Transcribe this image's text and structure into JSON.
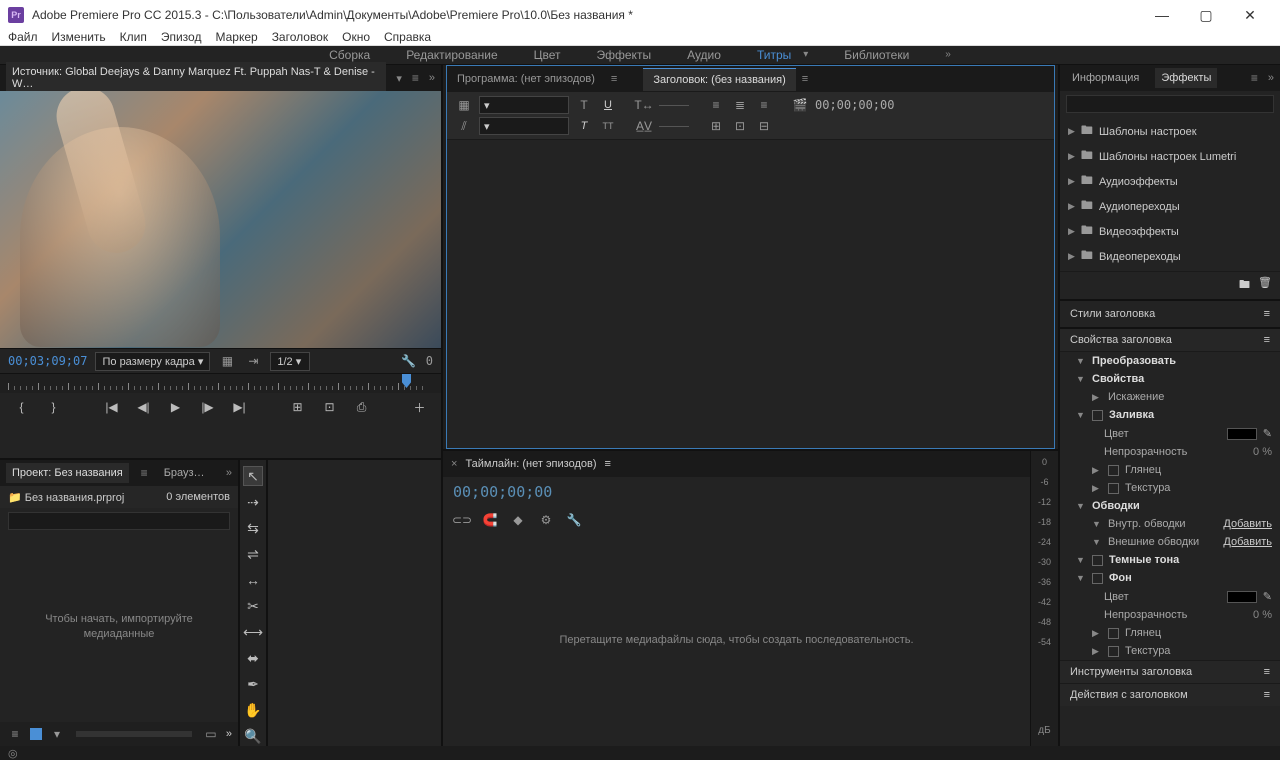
{
  "titlebar": {
    "app_icon": "Pr",
    "title": "Adobe Premiere Pro CC 2015.3 - C:\\Пользователи\\Admin\\Документы\\Adobe\\Premiere Pro\\10.0\\Без названия *"
  },
  "menubar": [
    "Файл",
    "Изменить",
    "Клип",
    "Эпизод",
    "Маркер",
    "Заголовок",
    "Окно",
    "Справка"
  ],
  "workspaces": {
    "items": [
      "Сборка",
      "Редактирование",
      "Цвет",
      "Эффекты",
      "Аудио",
      "Титры",
      "Библиотеки"
    ],
    "active": "Титры"
  },
  "source": {
    "tab": "Источник: Global Deejays & Danny Marquez Ft. Puppah Nas-T & Denise - W…",
    "timecode": "00;03;09;07",
    "fit_label": "По размеру кадра",
    "scale": "1/2",
    "end_tc": "0"
  },
  "title_editor": {
    "tab_program": "Программа: (нет эпизодов)",
    "tab_title": "Заголовок: (без названия)",
    "tc": "00;00;00;00"
  },
  "effects_panel": {
    "tab_info": "Информация",
    "tab_fx": "Эффекты",
    "search_placeholder": "",
    "folders": [
      "Шаблоны настроек",
      "Шаблоны настроек Lumetri",
      "Аудиоэффекты",
      "Аудиопереходы",
      "Видеоэффекты",
      "Видеопереходы"
    ]
  },
  "styles_panel": "Стили заголовка",
  "props": {
    "head": "Свойства заголовка",
    "transform": "Преобразовать",
    "properties": "Свойства",
    "distort": "Искажение",
    "fill": "Заливка",
    "color": "Цвет",
    "opacity": "Непрозрачность",
    "opacity_val": "0 %",
    "gloss": "Глянец",
    "texture": "Текстура",
    "strokes": "Обводки",
    "inner_strokes": "Внутр. обводки",
    "outer_strokes": "Внешние обводки",
    "add": "Добавить",
    "shadows": "Темные тона",
    "background": "Фон",
    "tools": "Инструменты заголовка",
    "actions": "Действия с заголовком"
  },
  "project": {
    "tab_project": "Проект: Без названия",
    "tab_browser": "Брауз…",
    "filename": "Без названия.prproj",
    "count": "0 элементов",
    "empty_msg": "Чтобы начать, импортируйте медиаданные",
    "search_placeholder": ""
  },
  "timeline": {
    "tab": "Таймлайн: (нет эпизодов)",
    "tc": "00;00;00;00",
    "empty_msg": "Перетащите медиафайлы сюда, чтобы создать последовательность."
  },
  "audio_levels": [
    "0",
    "-6",
    "-12",
    "-18",
    "-24",
    "-30",
    "-36",
    "-42",
    "-48",
    "-54"
  ],
  "audio_label": "дБ"
}
